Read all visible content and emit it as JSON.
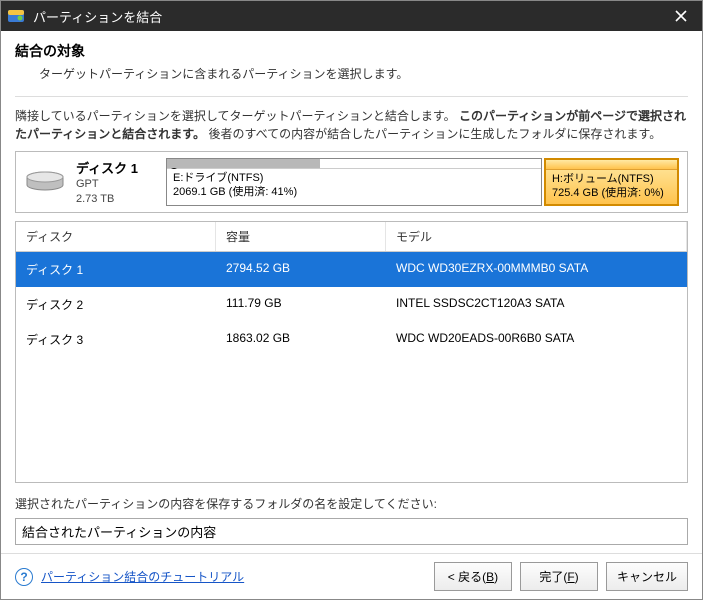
{
  "window": {
    "title": "パーティションを結合"
  },
  "header": {
    "title": "結合の対象",
    "subtitle": "ターゲットパーティションに含まれるパーティションを選択します。"
  },
  "instruction": {
    "pre": "隣接しているパーティションを選択してターゲットパーティションと結合します。",
    "bold": "このパーティションが前ページで選択されたパーティションと結合されます。",
    "post": "後者のすべての内容が結合したパーティションに生成したフォルダに保存されます。"
  },
  "disk": {
    "name": "ディスク 1",
    "scheme": "GPT",
    "size": "2.73 TB"
  },
  "partitions": [
    {
      "label": "E:ドライブ(NTFS)",
      "detail": "2069.1 GB (使用済: 41%)",
      "usedPct": 41,
      "selected": false,
      "checked": true
    },
    {
      "label": "H:ボリューム(NTFS)",
      "detail": "725.4 GB (使用済: 0%)",
      "usedPct": 0,
      "selected": true,
      "checked": false
    }
  ],
  "table": {
    "headers": {
      "c1": "ディスク",
      "c2": "容量",
      "c3": "モデル"
    },
    "rows": [
      {
        "c1": "ディスク 1",
        "c2": "2794.52 GB",
        "c3": "WDC WD30EZRX-00MMMB0 SATA",
        "selected": true
      },
      {
        "c1": "ディスク 2",
        "c2": "111.79 GB",
        "c3": "INTEL SSDSC2CT120A3 SATA",
        "selected": false
      },
      {
        "c1": "ディスク 3",
        "c2": "1863.02 GB",
        "c3": "WDC WD20EADS-00R6B0 SATA",
        "selected": false
      }
    ]
  },
  "folder": {
    "label": "選択されたパーティションの内容を保存するフォルダの名を設定してください:",
    "value": "結合されたパーティションの内容"
  },
  "footer": {
    "help": "パーティション結合のチュートリアル",
    "back_pre": "< 戻る(",
    "back_u": "B",
    "back_post": ")",
    "finish_pre": "完了(",
    "finish_u": "F",
    "finish_post": ")",
    "cancel": "キャンセル"
  }
}
